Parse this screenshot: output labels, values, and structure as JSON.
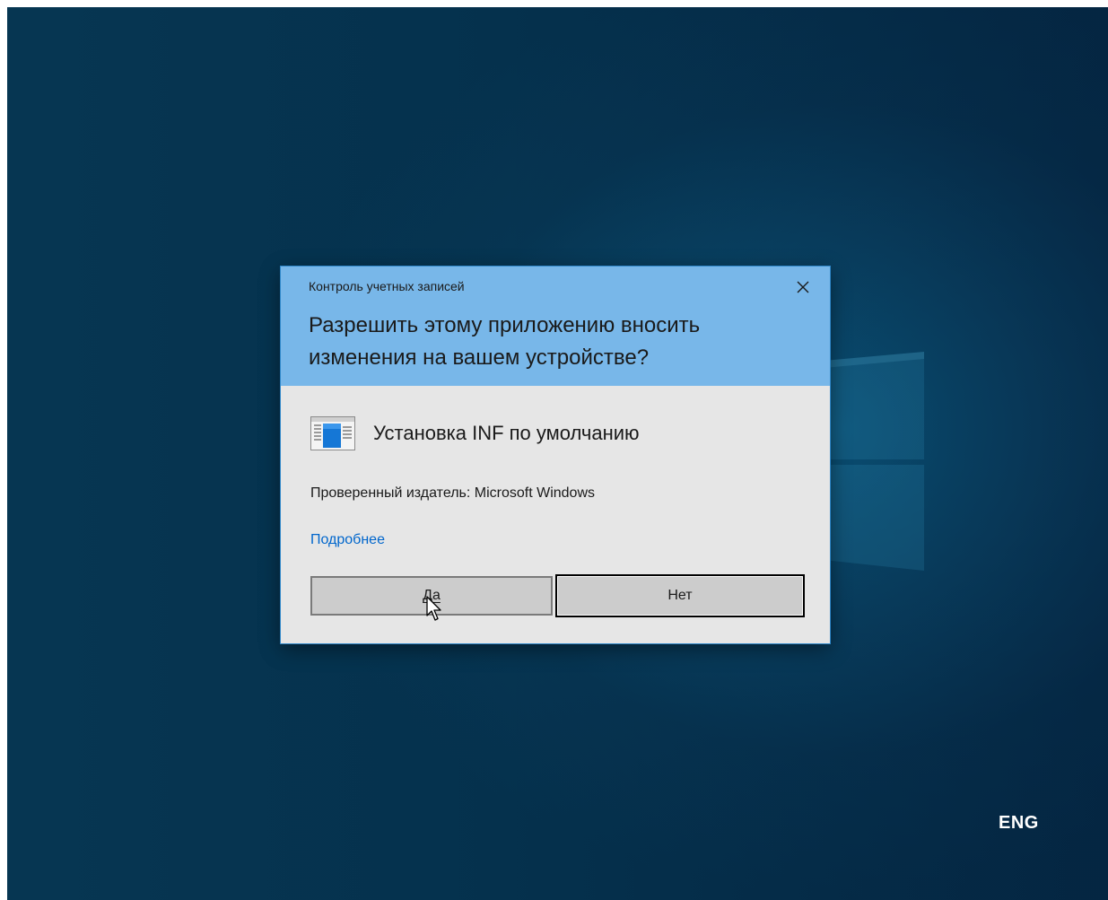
{
  "dialog": {
    "caption": "Контроль учетных записей",
    "question": "Разрешить этому приложению вносить изменения на вашем устройстве?",
    "app_name": "Установка INF по умолчанию",
    "publisher": "Проверенный издатель: Microsoft Windows",
    "details_link": "Подробнее",
    "yes_label": "Да",
    "no_label": "Нет",
    "close_icon": "close-icon",
    "app_icon": "installer-window-icon"
  },
  "taskbar": {
    "language": "ENG"
  },
  "colors": {
    "header_bg": "#78b7e9",
    "body_bg": "#e6e6e6",
    "button_bg": "#cccccc",
    "link": "#0066cc",
    "desktop": "#05314d"
  }
}
